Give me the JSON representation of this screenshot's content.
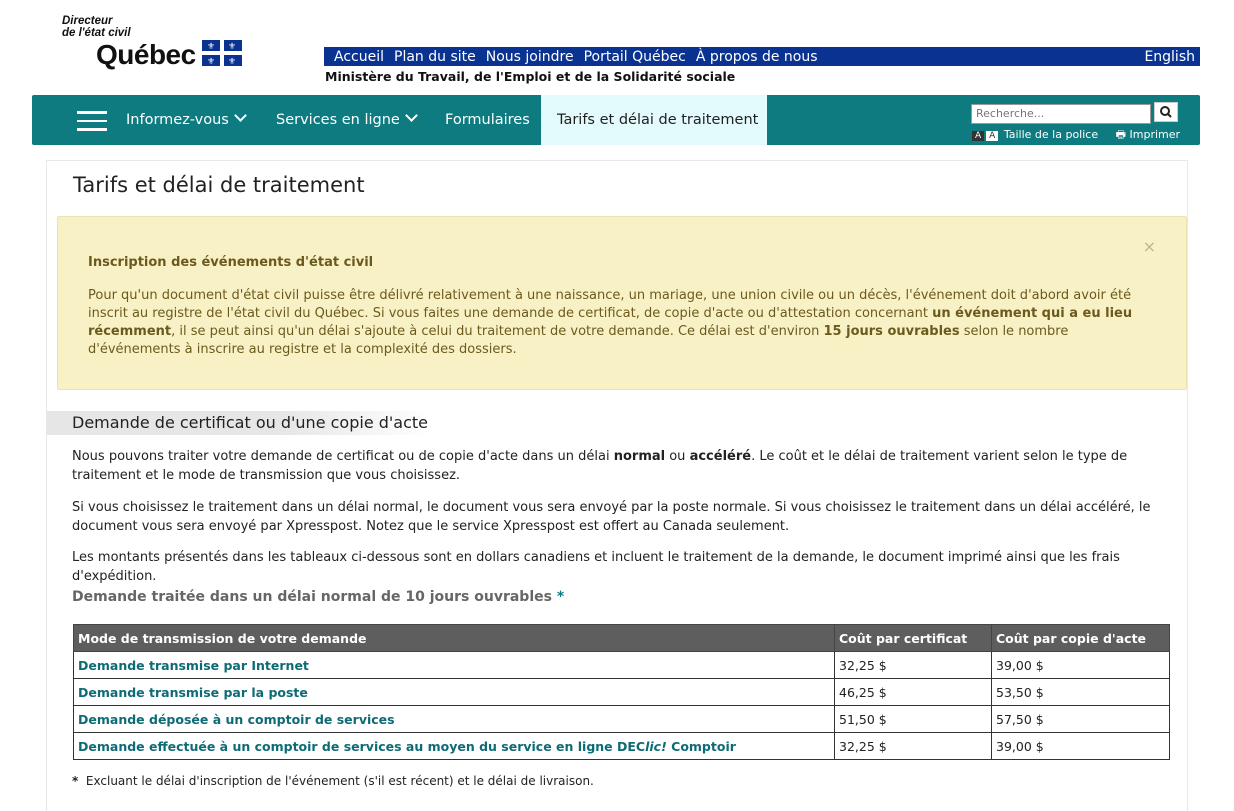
{
  "logo": {
    "line1": "Directeur",
    "line2": "de l'état civil",
    "name": "Québec",
    "flag_icon": "quebec-fleurdelise-flag"
  },
  "topbar": {
    "links": [
      "Accueil",
      "Plan du site",
      "Nous joindre",
      "Portail Québec",
      "À propos de nous"
    ],
    "english": "English"
  },
  "ministere": "Ministère du Travail, de l'Emploi et de la Solidarité sociale",
  "nav": {
    "items": [
      "Informez-vous",
      "Services en ligne",
      "Formulaires"
    ],
    "active": "Tarifs et délai de traitement",
    "search_placeholder": "Recherche...",
    "font_size_label": "Taille de la police",
    "print_label": "Imprimer"
  },
  "colors": {
    "nav": "#0d7b80",
    "topbar": "#0a3391",
    "alert_bg": "#f9f1c6"
  },
  "page_title": "Tarifs et délai de traitement",
  "alert": {
    "title": "Inscription des événements d'état civil",
    "p1": "Pour qu'un document d'état civil puisse être délivré relativement à une naissance, un mariage, une union civile ou un décès, l'événement doit d'abord avoir été inscrit au registre de l'état civil du Québec. Si vous faites une demande de certificat, de copie d'acte ou d'attestation concernant ",
    "b1": "un événement qui a eu lieu récemment",
    "p2": ", il se peut ainsi qu'un délai s'ajoute à celui du traitement de votre demande. Ce délai est d'environ ",
    "b2": "15 jours ouvrables",
    "p3": " selon le nombre d'événements à inscrire au registre et la complexité des dossiers.",
    "close": "×"
  },
  "section": {
    "title": "Demande de certificat ou d'une copie d'acte",
    "para1_a": "Nous pouvons traiter votre demande de certificat ou de copie d'acte dans un délai ",
    "para1_b1": "normal",
    "para1_c": " ou ",
    "para1_b2": "accéléré",
    "para1_d": ". Le coût et le délai de traitement varient selon le type de traitement et le mode de transmission que vous choisissez.",
    "para2": "Si vous choisissez le traitement dans un délai normal, le document vous sera envoyé par la poste normale. Si vous choisissez le traitement dans un délai accéléré, le document vous sera envoyé par Xpresspost. Notez que le service Xpresspost est offert au Canada seulement.",
    "para3": "Les montants présentés dans les tableaux ci-dessous sont en dollars canadiens et incluent le traitement de la demande, le document imprimé ainsi que les frais d'expédition.",
    "subtitle": "Demande traitée dans un délai normal de 10 jours ouvrables",
    "subtitle_mark": "*"
  },
  "table": {
    "headers": [
      "Mode de transmission de votre demande",
      "Coût par certificat",
      "Coût par copie d'acte"
    ],
    "rows": [
      [
        "Demande transmise par Internet",
        "32,25 $",
        "39,00 $"
      ],
      [
        "Demande transmise par la poste",
        "46,25 $",
        "53,50 $"
      ],
      [
        "Demande déposée à un comptoir de services",
        "51,50 $",
        "57,50 $"
      ]
    ],
    "row4": {
      "a": "Demande effectuée à un comptoir de services au moyen du service en ligne DEC",
      "b": "lic!",
      "c": " Comptoir",
      "cert": "32,25 $",
      "copy": "39,00 $"
    }
  },
  "footnote": {
    "mark": "*",
    "text": "Excluant le délai d'inscription de l'événement (s'il est récent) et le délai de livraison."
  }
}
